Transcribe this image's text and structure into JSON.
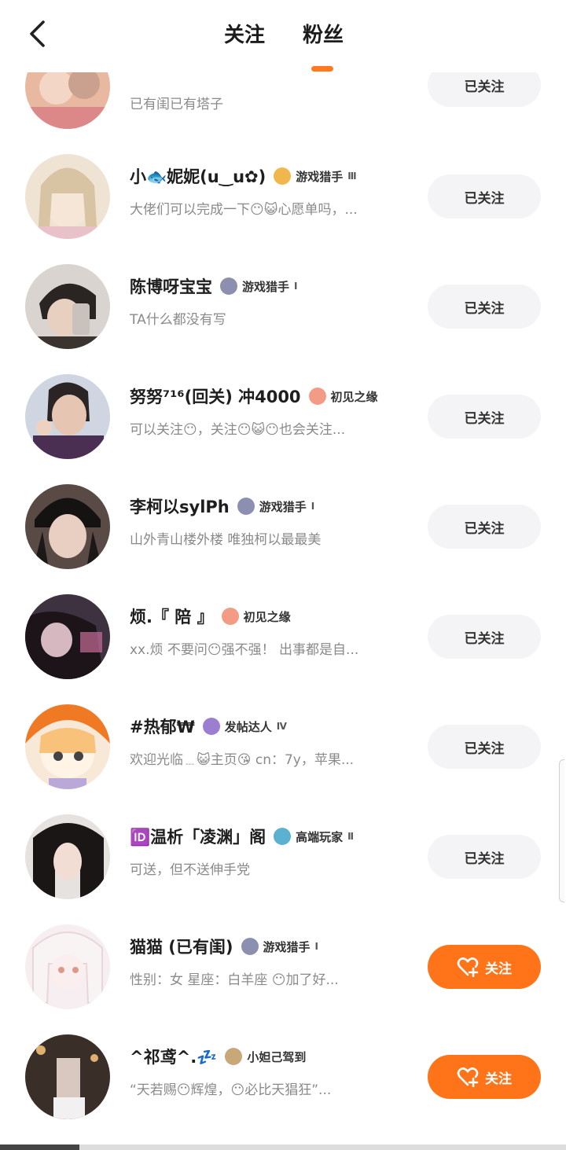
{
  "header": {
    "tab_following": "关注",
    "tab_fans": "粉丝"
  },
  "colors": {
    "accent": "#ff7418",
    "followed_bg": "#f4f4f6",
    "bio_gray": "#8a8a8a"
  },
  "users": [
    {
      "name": "",
      "badge": "",
      "level": "",
      "bio": "已有闺已有塔子",
      "button": "已关注",
      "followed": true,
      "avatar": "#e8b8a0"
    },
    {
      "name": "小🐟妮妮(u‿u✿)",
      "badge": "游戏猎手",
      "level": "Ⅲ",
      "bio": "大佬们可以完成一下😶😺心愿单吗，...",
      "button": "已关注",
      "followed": true,
      "avatar": "#e9d6c0"
    },
    {
      "name": "陈博呀宝宝",
      "badge": "游戏猎手",
      "level": "Ⅰ",
      "bio": "TA什么都没有写",
      "button": "已关注",
      "followed": true,
      "avatar": "#6b5a50"
    },
    {
      "name": "努努⁷¹⁶(回关) 冲4000",
      "badge": "初见之缘",
      "level": "",
      "bio": "可以关注😶，关注😶😺😶也会关注...",
      "button": "已关注",
      "followed": true,
      "avatar": "#c9b6c8"
    },
    {
      "name": "李柯以sylPh",
      "badge": "游戏猎手",
      "level": "Ⅰ",
      "bio": "山外青山楼外楼 唯独柯以最最美",
      "button": "已关注",
      "followed": true,
      "avatar": "#3c3230"
    },
    {
      "name": "烦.『 陪 』",
      "badge": "初见之缘",
      "level": "",
      "bio": "xx.烦 不要问😶强不强！ 出事都是自...",
      "button": "已关注",
      "followed": true,
      "avatar": "#4a3a48"
    },
    {
      "name": "#热郁₩",
      "badge": "发帖达人",
      "level": "Ⅳ",
      "bio": "欢迎光临﹍😺主页😘 cn：7y，苹果...",
      "button": "已关注",
      "followed": true,
      "avatar": "#f4a860"
    },
    {
      "name": "🆔温析「凌渊」阁",
      "badge": "高端玩家",
      "level": "Ⅱ",
      "bio": "可送，但不送伸手党",
      "button": "已关注",
      "followed": true,
      "avatar": "#5a5050"
    },
    {
      "name": "猫猫 (已有闺)",
      "badge": "游戏猎手",
      "level": "Ⅰ",
      "bio": "性别：女 星座：白羊座 😶加了好...",
      "button": "关注",
      "followed": false,
      "avatar": "#f2e4e8"
    },
    {
      "name": "^祁鸢^.💤",
      "badge": "小妲己驾到",
      "level": "",
      "bio": "“天若赐😶辉煌，😶必比天猖狂”...",
      "button": "关注",
      "followed": false,
      "avatar": "#4a3a30"
    }
  ]
}
